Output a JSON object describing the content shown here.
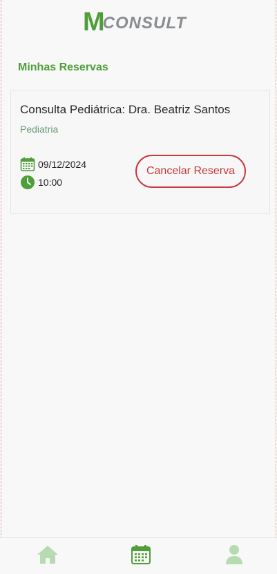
{
  "brand": {
    "logo_initial": "M",
    "logo_rest": "CONSULT"
  },
  "page": {
    "title": "Minhas Reservas"
  },
  "reservations": [
    {
      "title": "Consulta Pediátrica: Dra. Beatriz Santos",
      "specialty": "Pediatria",
      "date": "09/12/2024",
      "time": "10:00",
      "cancel_label": "Cancelar Reserva"
    }
  ],
  "nav": {
    "items": [
      {
        "icon": "home-icon",
        "active": false
      },
      {
        "icon": "calendar-icon",
        "active": true
      },
      {
        "icon": "user-icon",
        "active": false
      }
    ]
  },
  "colors": {
    "brand_green": "#4f9e39",
    "brand_gray": "#8a8d90",
    "danger": "#c9373f",
    "muted_green": "#6e9a7b",
    "inactive_nav": "#b6dbb0"
  }
}
